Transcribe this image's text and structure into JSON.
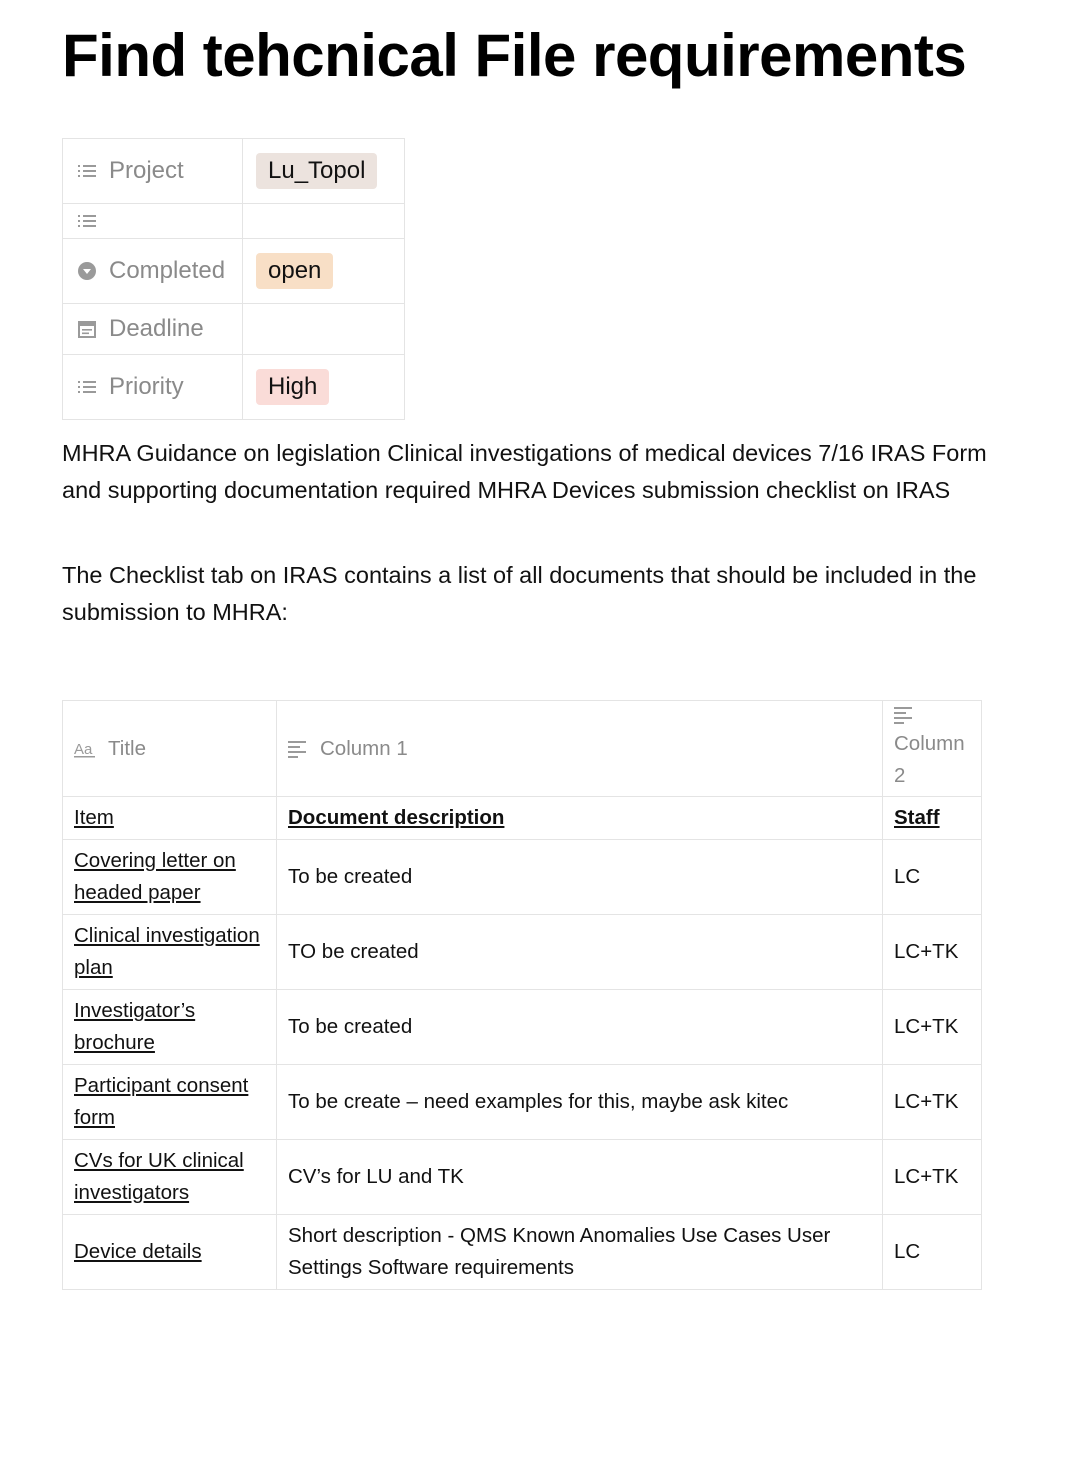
{
  "page": {
    "title": "Find tehcnical File requirements"
  },
  "properties": [
    {
      "label": "Project",
      "icon": "list-icon",
      "value": "Lu_Topol",
      "tag_color": "#ece3de"
    },
    {
      "label": "",
      "icon": "list-icon",
      "value": "",
      "tag_color": ""
    },
    {
      "label": "Completed",
      "icon": "chevron-circle-icon",
      "value": "open",
      "tag_color": "#f8dfc6"
    },
    {
      "label": "Deadline",
      "icon": "calendar-icon",
      "value": "",
      "tag_color": ""
    },
    {
      "label": "Priority",
      "icon": "list-icon",
      "value": "High",
      "tag_color": "#fadcd8"
    }
  ],
  "body": {
    "paragraph1": "MHRA Guidance on legislation Clinical investigations of medical devices 7/16 IRAS Form and supporting documentation required MHRA Devices submission checklist on IRAS",
    "paragraph2": "The Checklist tab on IRAS contains a list of all documents that should be included in the submission to MHRA:"
  },
  "table": {
    "columns": [
      {
        "label": "Title",
        "icon": "text-aa-icon"
      },
      {
        "label": "Column 1",
        "icon": "text-lines-icon"
      },
      {
        "label": "Column 2",
        "icon": "text-lines-icon"
      }
    ],
    "header_row": {
      "item": "Item",
      "description": "Document description",
      "staff": "Staff"
    },
    "rows": [
      {
        "item": "Covering letter on headed paper",
        "description": "To be created",
        "staff": "LC"
      },
      {
        "item": "Clinical investigation plan",
        "description": "TO be created",
        "staff": "LC+TK"
      },
      {
        "item": "Investigator’s brochure",
        "description": "To be created",
        "staff": "LC+TK"
      },
      {
        "item": "Participant consent form",
        "description": "To be create – need examples for this, maybe ask kitec",
        "staff": "LC+TK"
      },
      {
        "item": "CVs for UK clinical investigators",
        "description": "CV’s for LU and TK",
        "staff": "LC+TK"
      },
      {
        "item": "Device details",
        "description": "Short description - QMS Known Anomalies Use Cases User Settings Software requirements",
        "staff": "LC"
      }
    ]
  }
}
